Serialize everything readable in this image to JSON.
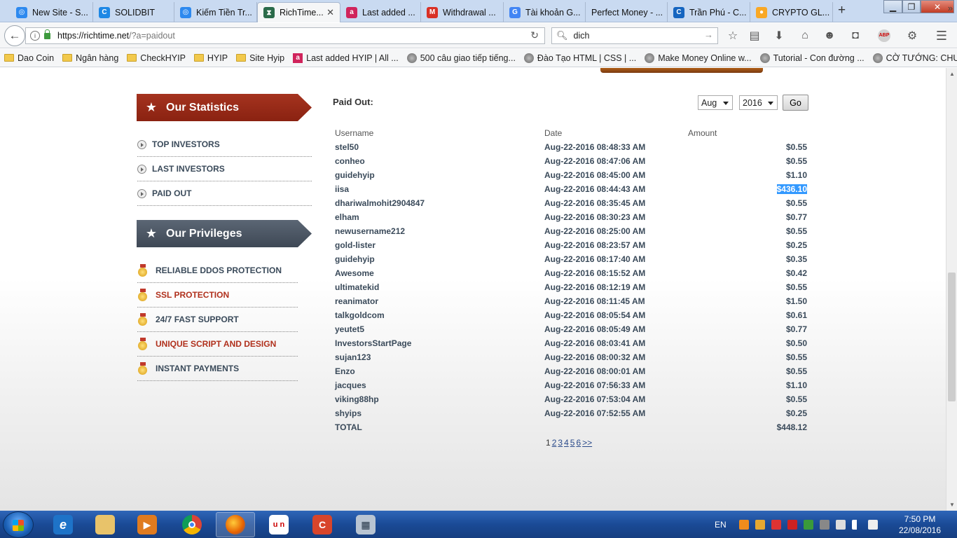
{
  "browser": {
    "tabs": [
      {
        "label": "New Site - S...",
        "icon": "site-icon",
        "color": "#2d89ef"
      },
      {
        "label": "SOLIDBIT",
        "icon": "c-icon",
        "color": "#1e88e5"
      },
      {
        "label": "Kiếm Tiền Tr...",
        "icon": "site-icon",
        "color": "#2d89ef"
      },
      {
        "label": "RichTime...",
        "icon": "hourglass-icon",
        "color": "#2b6b4a",
        "active": true
      },
      {
        "label": "Last added ...",
        "icon": "a-icon",
        "color": "#d0245c"
      },
      {
        "label": "Withdrawal ...",
        "icon": "gmail-icon",
        "color": "#d93025"
      },
      {
        "label": "Tài khoản G...",
        "icon": "google-icon",
        "color": "#4285f4"
      },
      {
        "label": "Perfect Money - ...",
        "icon": "",
        "color": ""
      },
      {
        "label": "Trần Phú - C...",
        "icon": "c-icon",
        "color": "#1565c0"
      },
      {
        "label": "CRYPTO GL...",
        "icon": "coin-icon",
        "color": "#f9a825"
      }
    ],
    "new_tab": "+",
    "url_host": "https://richtime.net",
    "url_path": "/?a=paidout",
    "search_value": "dich"
  },
  "bookmarks": [
    {
      "label": "Dao Coin",
      "type": "folder"
    },
    {
      "label": "Ngân hàng",
      "type": "folder"
    },
    {
      "label": "CheckHYIP",
      "type": "folder"
    },
    {
      "label": "HYIP",
      "type": "folder"
    },
    {
      "label": "Site Hyip",
      "type": "folder"
    },
    {
      "label": "Last added HYIP | All ...",
      "type": "a"
    },
    {
      "label": "500 câu giao tiếp tiếng...",
      "type": "globe"
    },
    {
      "label": "Đào Tạo HTML | CSS | ...",
      "type": "globe"
    },
    {
      "label": "Make Money Online w...",
      "type": "globe"
    },
    {
      "label": "Tutorial - Con đường ...",
      "type": "globe"
    },
    {
      "label": "CỜ TƯỚNG: CHUYÊN ...",
      "type": "globe"
    }
  ],
  "sidebar": {
    "stats_title": "Our Statistics",
    "stats_items": [
      "TOP INVESTORS",
      "LAST INVESTORS",
      "PAID OUT"
    ],
    "priv_title": "Our Privileges",
    "priv_items": [
      {
        "label": "RELIABLE DDOS PROTECTION",
        "color": "#3a4a5a"
      },
      {
        "label": "SSL PROTECTION",
        "color": "#b0301c"
      },
      {
        "label": "24/7 FAST SUPPORT",
        "color": "#3a4a5a"
      },
      {
        "label": "UNIQUE SCRIPT AND DESIGN",
        "color": "#b0301c"
      },
      {
        "label": "INSTANT PAYMENTS",
        "color": "#3a4a5a"
      }
    ]
  },
  "paidout": {
    "title": "Paid Out:",
    "month": "Aug",
    "year": "2016",
    "go_label": "Go",
    "headers": {
      "username": "Username",
      "date": "Date",
      "amount": "Amount"
    },
    "rows": [
      {
        "user": "stel50",
        "date": "Aug-22-2016 08:48:33 AM",
        "amount": "$0.55"
      },
      {
        "user": "conheo",
        "date": "Aug-22-2016 08:47:06 AM",
        "amount": "$0.55"
      },
      {
        "user": "guidehyip",
        "date": "Aug-22-2016 08:45:00 AM",
        "amount": "$1.10"
      },
      {
        "user": "iisa",
        "date": "Aug-22-2016 08:44:43 AM",
        "amount": "$436.10",
        "selected": true
      },
      {
        "user": "dhariwalmohit2904847",
        "date": "Aug-22-2016 08:35:45 AM",
        "amount": "$0.55"
      },
      {
        "user": "elham",
        "date": "Aug-22-2016 08:30:23 AM",
        "amount": "$0.77"
      },
      {
        "user": "newusername212",
        "date": "Aug-22-2016 08:25:00 AM",
        "amount": "$0.55"
      },
      {
        "user": "gold-lister",
        "date": "Aug-22-2016 08:23:57 AM",
        "amount": "$0.25"
      },
      {
        "user": "guidehyip",
        "date": "Aug-22-2016 08:17:40 AM",
        "amount": "$0.35"
      },
      {
        "user": "Awesome",
        "date": "Aug-22-2016 08:15:52 AM",
        "amount": "$0.42"
      },
      {
        "user": "ultimatekid",
        "date": "Aug-22-2016 08:12:19 AM",
        "amount": "$0.55"
      },
      {
        "user": "reanimator",
        "date": "Aug-22-2016 08:11:45 AM",
        "amount": "$1.50"
      },
      {
        "user": "talkgoldcom",
        "date": "Aug-22-2016 08:05:54 AM",
        "amount": "$0.61"
      },
      {
        "user": "yeutet5",
        "date": "Aug-22-2016 08:05:49 AM",
        "amount": "$0.77"
      },
      {
        "user": "InvestorsStartPage",
        "date": "Aug-22-2016 08:03:41 AM",
        "amount": "$0.50"
      },
      {
        "user": "sujan123",
        "date": "Aug-22-2016 08:00:32 AM",
        "amount": "$0.55"
      },
      {
        "user": "Enzo",
        "date": "Aug-22-2016 08:00:01 AM",
        "amount": "$0.55"
      },
      {
        "user": "jacques",
        "date": "Aug-22-2016 07:56:33 AM",
        "amount": "$1.10"
      },
      {
        "user": "viking88hp",
        "date": "Aug-22-2016 07:53:04 AM",
        "amount": "$0.55"
      },
      {
        "user": "shyips",
        "date": "Aug-22-2016 07:52:55 AM",
        "amount": "$0.25"
      }
    ],
    "total_label": "TOTAL",
    "total_amount": "$448.12",
    "pager_current": "1",
    "pager_pages": [
      "2",
      "3",
      "4",
      "5",
      "6"
    ],
    "pager_next": ">>"
  },
  "taskbar": {
    "lang": "EN",
    "time": "7:50 PM",
    "date": "22/08/2016"
  }
}
